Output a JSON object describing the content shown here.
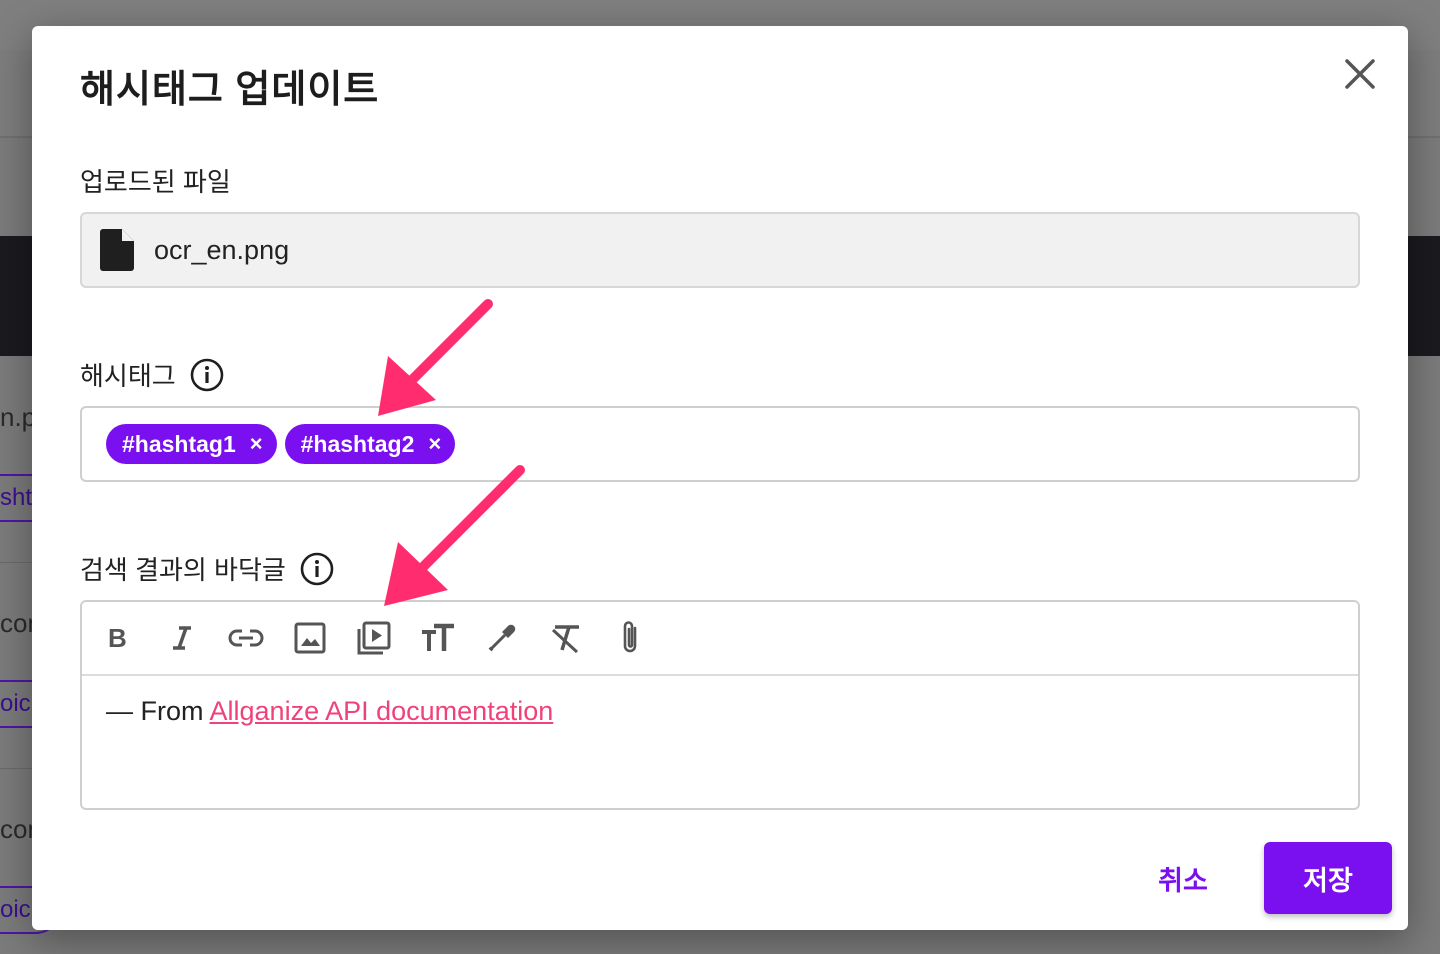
{
  "background": {
    "row1_text": "n.p",
    "row1_tag": "sht",
    "row2_text": "con",
    "row2_tag": "oic",
    "row3_text": "con",
    "row3_tag": "oic"
  },
  "modal": {
    "title": "해시태그 업데이트",
    "close_icon": "close-icon"
  },
  "uploaded_file": {
    "label": "업로드된 파일",
    "icon": "file-icon",
    "filename": "ocr_en.png"
  },
  "hashtags": {
    "label": "해시태그",
    "info_icon": "info-icon",
    "tags": [
      {
        "text": "#hashtag1",
        "remove": "×"
      },
      {
        "text": "#hashtag2",
        "remove": "×"
      }
    ]
  },
  "footer_text": {
    "label": "검색 결과의 바닥글",
    "info_icon": "info-icon",
    "toolbar": [
      "bold-icon",
      "italic-icon",
      "link-icon",
      "image-icon",
      "video-icon",
      "text-size-icon",
      "color-picker-icon",
      "clear-format-icon",
      "attachment-icon"
    ],
    "content_prefix": "— From ",
    "content_link": "Allganize API documentation"
  },
  "actions": {
    "cancel_label": "취소",
    "save_label": "저장"
  },
  "colors": {
    "accent": "#7a0ff0",
    "link": "#f0427a",
    "arrow": "#ff2d6f"
  }
}
